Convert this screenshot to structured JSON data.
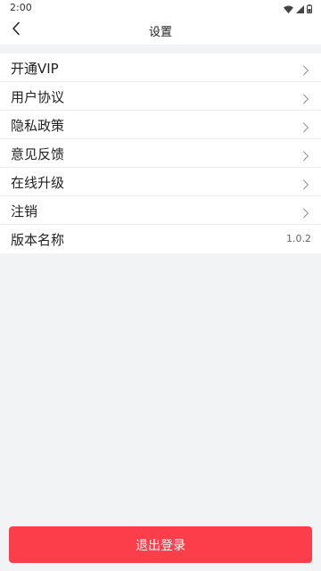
{
  "status_bar": {
    "time": "2:00",
    "icons": [
      "wifi-icon",
      "cell-signal-icon",
      "battery-icon"
    ]
  },
  "nav": {
    "title": "设置",
    "back_icon": "chevron-left-icon"
  },
  "menu": {
    "items": [
      {
        "label": "开通VIP",
        "trailing": "chevron-right-icon"
      },
      {
        "label": "用户协议",
        "trailing": "chevron-right-icon"
      },
      {
        "label": "隐私政策",
        "trailing": "chevron-right-icon"
      },
      {
        "label": "意见反馈",
        "trailing": "chevron-right-icon"
      },
      {
        "label": "在线升级",
        "trailing": "chevron-right-icon"
      },
      {
        "label": "注销",
        "trailing": "chevron-right-icon"
      },
      {
        "label": "版本名称",
        "value": "1.0.2"
      }
    ]
  },
  "logout": {
    "label": "退出登录"
  },
  "colors": {
    "page_background": "#f2f3f5",
    "accent": "#fc3e4b",
    "divider": "#ececec"
  }
}
